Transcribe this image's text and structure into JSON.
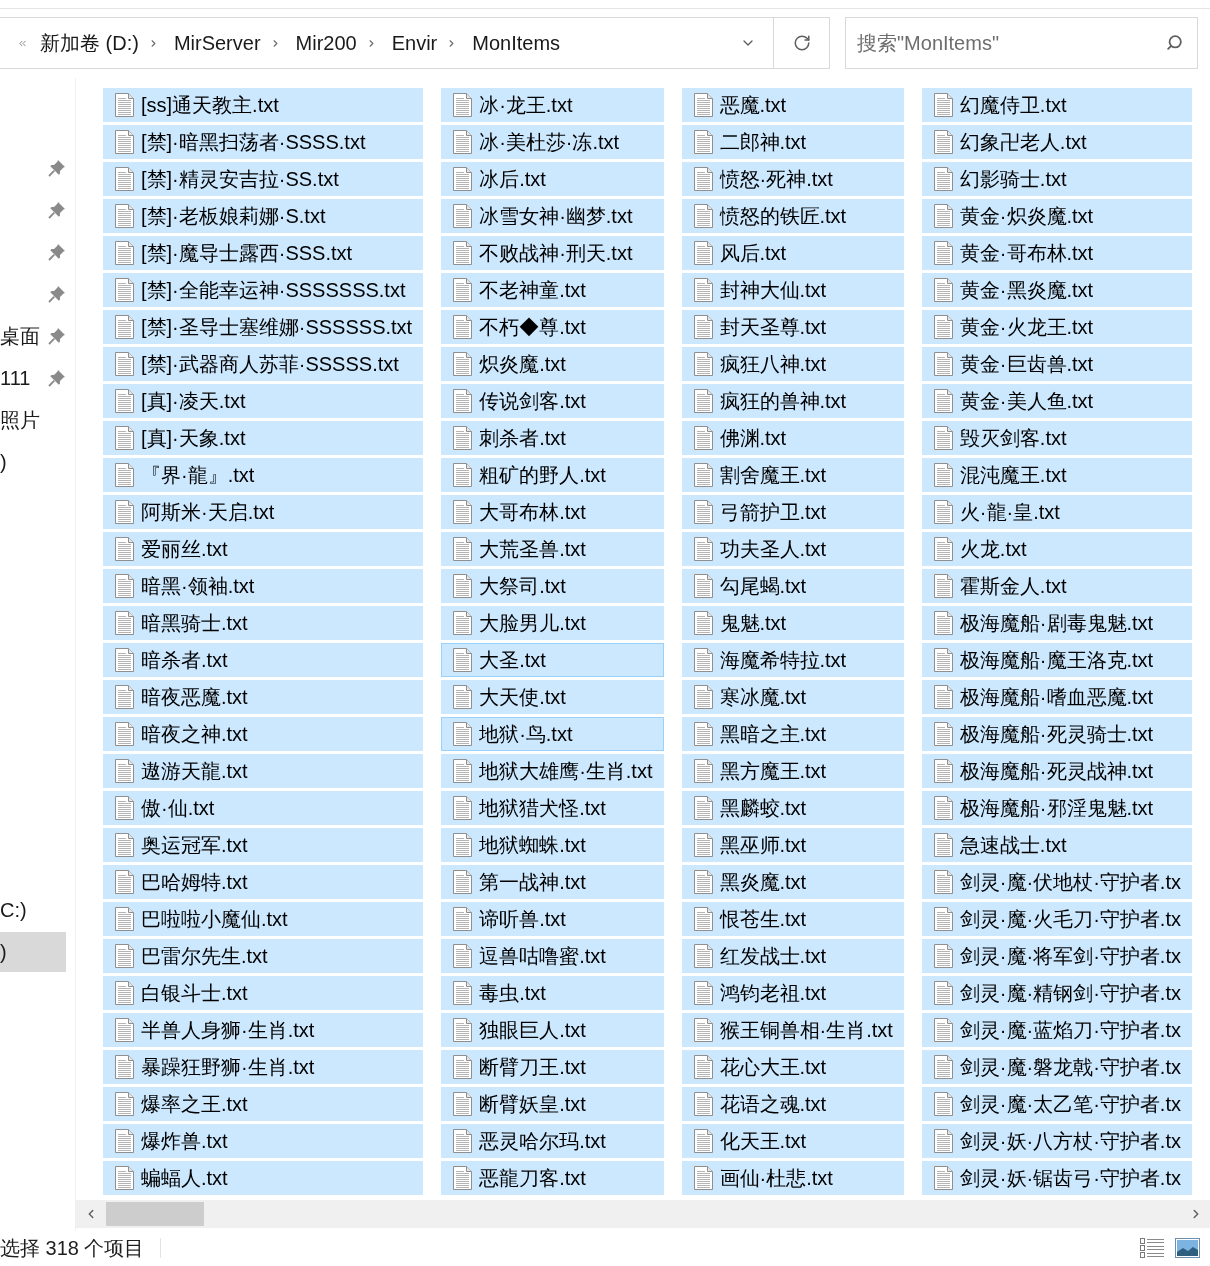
{
  "address_bar": {
    "breadcrumbs": [
      "新加卷 (D:)",
      "MirServer",
      "Mir200",
      "Envir",
      "MonItems"
    ]
  },
  "search": {
    "placeholder": "搜索\"MonItems\""
  },
  "navigation_pane": {
    "groups": [
      {
        "items": [
          {
            "pinned": true,
            "selected": false
          },
          {
            "pinned": true,
            "selected": false
          },
          {
            "pinned": true,
            "selected": false
          },
          {
            "pinned": true,
            "selected": false
          },
          {
            "label": "桌面",
            "pinned": true,
            "selected": false
          },
          {
            "label": "111",
            "pinned": true,
            "selected": false
          },
          {
            "label": "照片",
            "pinned": false,
            "selected": false
          },
          {
            "label": ")",
            "pinned": false,
            "selected": false
          }
        ]
      },
      {
        "items": [
          {
            "label": "C:)",
            "pinned": false,
            "selected": false
          },
          {
            "label": ")",
            "pinned": false,
            "selected": true
          }
        ]
      }
    ]
  },
  "files": [
    {
      "name": "[ss]通天教主.txt",
      "selected": true,
      "focused": false
    },
    {
      "name": "[禁]·暗黑扫荡者·SSSS.txt",
      "selected": true,
      "focused": false
    },
    {
      "name": "[禁]·精灵安吉拉·SS.txt",
      "selected": true,
      "focused": false
    },
    {
      "name": "[禁]·老板娘莉娜·S.txt",
      "selected": true,
      "focused": false
    },
    {
      "name": "[禁]·魔导士露西·SSS.txt",
      "selected": true,
      "focused": false
    },
    {
      "name": "[禁]·全能幸运神·SSSSSSS.txt",
      "selected": true,
      "focused": false
    },
    {
      "name": "[禁]·圣导士塞维娜·SSSSSS.txt",
      "selected": true,
      "focused": false
    },
    {
      "name": "[禁]·武器商人苏菲·SSSSS.txt",
      "selected": true,
      "focused": false
    },
    {
      "name": "[真]·凌天.txt",
      "selected": true,
      "focused": false
    },
    {
      "name": "[真]·天象.txt",
      "selected": true,
      "focused": false
    },
    {
      "name": "『界·龍』.txt",
      "selected": true,
      "focused": false
    },
    {
      "name": "阿斯米·天启.txt",
      "selected": true,
      "focused": false
    },
    {
      "name": "爱丽丝.txt",
      "selected": true,
      "focused": false
    },
    {
      "name": "暗黑·领袖.txt",
      "selected": true,
      "focused": false
    },
    {
      "name": "暗黑骑士.txt",
      "selected": true,
      "focused": false
    },
    {
      "name": "暗杀者.txt",
      "selected": true,
      "focused": false
    },
    {
      "name": "暗夜恶魔.txt",
      "selected": true,
      "focused": false
    },
    {
      "name": "暗夜之神.txt",
      "selected": true,
      "focused": false
    },
    {
      "name": "遨游天龍.txt",
      "selected": true,
      "focused": false
    },
    {
      "name": "傲·仙.txt",
      "selected": true,
      "focused": false
    },
    {
      "name": "奥运冠军.txt",
      "selected": true,
      "focused": false
    },
    {
      "name": "巴哈姆特.txt",
      "selected": true,
      "focused": false
    },
    {
      "name": "巴啦啦小魔仙.txt",
      "selected": true,
      "focused": false
    },
    {
      "name": "巴雷尔先生.txt",
      "selected": true,
      "focused": false
    },
    {
      "name": "白银斗士.txt",
      "selected": true,
      "focused": false
    },
    {
      "name": "半兽人身狮·生肖.txt",
      "selected": true,
      "focused": false
    },
    {
      "name": "暴躁狂野狮·生肖.txt",
      "selected": true,
      "focused": false
    },
    {
      "name": "爆率之王.txt",
      "selected": true,
      "focused": false
    },
    {
      "name": "爆炸兽.txt",
      "selected": true,
      "focused": false
    },
    {
      "name": "蝙蝠人.txt",
      "selected": true,
      "focused": false
    },
    {
      "name": "冰·龙王.txt",
      "selected": true,
      "focused": false
    },
    {
      "name": "冰·美杜莎·冻.txt",
      "selected": true,
      "focused": false
    },
    {
      "name": "冰后.txt",
      "selected": true,
      "focused": false
    },
    {
      "name": "冰雪女神·幽梦.txt",
      "selected": true,
      "focused": false
    },
    {
      "name": "不败战神·刑天.txt",
      "selected": true,
      "focused": false
    },
    {
      "name": "不老神童.txt",
      "selected": true,
      "focused": false
    },
    {
      "name": "不朽◆尊.txt",
      "selected": true,
      "focused": false
    },
    {
      "name": "炽炎魔.txt",
      "selected": true,
      "focused": false
    },
    {
      "name": "传说剑客.txt",
      "selected": true,
      "focused": false
    },
    {
      "name": "刺杀者.txt",
      "selected": true,
      "focused": false
    },
    {
      "name": "粗矿的野人.txt",
      "selected": true,
      "focused": false
    },
    {
      "name": "大哥布林.txt",
      "selected": true,
      "focused": false
    },
    {
      "name": "大荒圣兽.txt",
      "selected": true,
      "focused": false
    },
    {
      "name": "大祭司.txt",
      "selected": true,
      "focused": false
    },
    {
      "name": "大脸男儿.txt",
      "selected": true,
      "focused": false
    },
    {
      "name": "大圣.txt",
      "selected": true,
      "focused": true
    },
    {
      "name": "大天使.txt",
      "selected": true,
      "focused": false
    },
    {
      "name": "地狱·鸟.txt",
      "selected": true,
      "focused": true
    },
    {
      "name": "地狱大雄鹰·生肖.txt",
      "selected": true,
      "focused": false
    },
    {
      "name": "地狱猎犬怪.txt",
      "selected": true,
      "focused": false
    },
    {
      "name": "地狱蜘蛛.txt",
      "selected": true,
      "focused": false
    },
    {
      "name": "第一战神.txt",
      "selected": true,
      "focused": false
    },
    {
      "name": "谛听兽.txt",
      "selected": true,
      "focused": false
    },
    {
      "name": "逗兽咕噜蜜.txt",
      "selected": true,
      "focused": false
    },
    {
      "name": "毒虫.txt",
      "selected": true,
      "focused": false
    },
    {
      "name": "独眼巨人.txt",
      "selected": true,
      "focused": false
    },
    {
      "name": "断臂刀王.txt",
      "selected": true,
      "focused": false
    },
    {
      "name": "断臂妖皇.txt",
      "selected": true,
      "focused": false
    },
    {
      "name": "恶灵哈尔玛.txt",
      "selected": true,
      "focused": false
    },
    {
      "name": "恶龍刀客.txt",
      "selected": true,
      "focused": false
    },
    {
      "name": "恶魔.txt",
      "selected": true,
      "focused": false
    },
    {
      "name": "二郎神.txt",
      "selected": true,
      "focused": false
    },
    {
      "name": "愤怒·死神.txt",
      "selected": true,
      "focused": false
    },
    {
      "name": "愤怒的铁匠.txt",
      "selected": true,
      "focused": false
    },
    {
      "name": "风后.txt",
      "selected": true,
      "focused": false
    },
    {
      "name": "封神大仙.txt",
      "selected": true,
      "focused": false
    },
    {
      "name": "封天圣尊.txt",
      "selected": true,
      "focused": false
    },
    {
      "name": "疯狂八神.txt",
      "selected": true,
      "focused": false
    },
    {
      "name": "疯狂的兽神.txt",
      "selected": true,
      "focused": false
    },
    {
      "name": "佛渊.txt",
      "selected": true,
      "focused": false
    },
    {
      "name": "割舍魔王.txt",
      "selected": true,
      "focused": false
    },
    {
      "name": "弓箭护卫.txt",
      "selected": true,
      "focused": false
    },
    {
      "name": "功夫圣人.txt",
      "selected": true,
      "focused": false
    },
    {
      "name": "勾尾蝎.txt",
      "selected": true,
      "focused": false
    },
    {
      "name": "鬼魅.txt",
      "selected": true,
      "focused": false
    },
    {
      "name": "海魔希特拉.txt",
      "selected": true,
      "focused": false
    },
    {
      "name": "寒冰魔.txt",
      "selected": true,
      "focused": false
    },
    {
      "name": "黑暗之主.txt",
      "selected": true,
      "focused": false
    },
    {
      "name": "黑方魔王.txt",
      "selected": true,
      "focused": false
    },
    {
      "name": "黑麟蛟.txt",
      "selected": true,
      "focused": false
    },
    {
      "name": "黑巫师.txt",
      "selected": true,
      "focused": false
    },
    {
      "name": "黑炎魔.txt",
      "selected": true,
      "focused": false
    },
    {
      "name": "恨苍生.txt",
      "selected": true,
      "focused": false
    },
    {
      "name": "红发战士.txt",
      "selected": true,
      "focused": false
    },
    {
      "name": "鸿钧老祖.txt",
      "selected": true,
      "focused": false
    },
    {
      "name": "猴王铜兽相·生肖.txt",
      "selected": true,
      "focused": false
    },
    {
      "name": "花心大王.txt",
      "selected": true,
      "focused": false
    },
    {
      "name": "花语之魂.txt",
      "selected": true,
      "focused": false
    },
    {
      "name": "化天王.txt",
      "selected": true,
      "focused": false
    },
    {
      "name": "画仙·杜悲.txt",
      "selected": true,
      "focused": false
    },
    {
      "name": "幻魔侍卫.txt",
      "selected": true,
      "focused": false
    },
    {
      "name": "幻象卍老人.txt",
      "selected": true,
      "focused": false
    },
    {
      "name": "幻影骑士.txt",
      "selected": true,
      "focused": false
    },
    {
      "name": "黄金·炽炎魔.txt",
      "selected": true,
      "focused": false
    },
    {
      "name": "黄金·哥布林.txt",
      "selected": true,
      "focused": false
    },
    {
      "name": "黄金·黑炎魔.txt",
      "selected": true,
      "focused": false
    },
    {
      "name": "黄金·火龙王.txt",
      "selected": true,
      "focused": false
    },
    {
      "name": "黄金·巨齿兽.txt",
      "selected": true,
      "focused": false
    },
    {
      "name": "黄金·美人鱼.txt",
      "selected": true,
      "focused": false
    },
    {
      "name": "毁灭剑客.txt",
      "selected": true,
      "focused": false
    },
    {
      "name": "混沌魔王.txt",
      "selected": true,
      "focused": false
    },
    {
      "name": "火·龍·皇.txt",
      "selected": true,
      "focused": false
    },
    {
      "name": "火龙.txt",
      "selected": true,
      "focused": false
    },
    {
      "name": "霍斯金人.txt",
      "selected": true,
      "focused": false
    },
    {
      "name": "极海魔船·剧毒鬼魅.txt",
      "selected": true,
      "focused": false
    },
    {
      "name": "极海魔船·魔王洛克.txt",
      "selected": true,
      "focused": false
    },
    {
      "name": "极海魔船·嗜血恶魔.txt",
      "selected": true,
      "focused": false
    },
    {
      "name": "极海魔船·死灵骑士.txt",
      "selected": true,
      "focused": false
    },
    {
      "name": "极海魔船·死灵战神.txt",
      "selected": true,
      "focused": false
    },
    {
      "name": "极海魔船·邪淫鬼魅.txt",
      "selected": true,
      "focused": false
    },
    {
      "name": "急速战士.txt",
      "selected": true,
      "focused": false
    },
    {
      "name": "剑灵·魔·伏地杖·守护者.tx",
      "selected": true,
      "focused": false
    },
    {
      "name": "剑灵·魔·火毛刀·守护者.tx",
      "selected": true,
      "focused": false
    },
    {
      "name": "剑灵·魔·将军剑·守护者.tx",
      "selected": true,
      "focused": false
    },
    {
      "name": "剑灵·魔·精钢剑·守护者.tx",
      "selected": true,
      "focused": false
    },
    {
      "name": "剑灵·魔·蓝焰刀·守护者.tx",
      "selected": true,
      "focused": false
    },
    {
      "name": "剑灵·魔·磐龙戟·守护者.tx",
      "selected": true,
      "focused": false
    },
    {
      "name": "剑灵·魔·太乙笔·守护者.tx",
      "selected": true,
      "focused": false
    },
    {
      "name": "剑灵·妖·八方杖·守护者.tx",
      "selected": true,
      "focused": false
    },
    {
      "name": "剑灵·妖·锯齿弓·守护者.tx",
      "selected": true,
      "focused": false
    }
  ],
  "status_bar": {
    "text": "选择 318 个项目"
  }
}
